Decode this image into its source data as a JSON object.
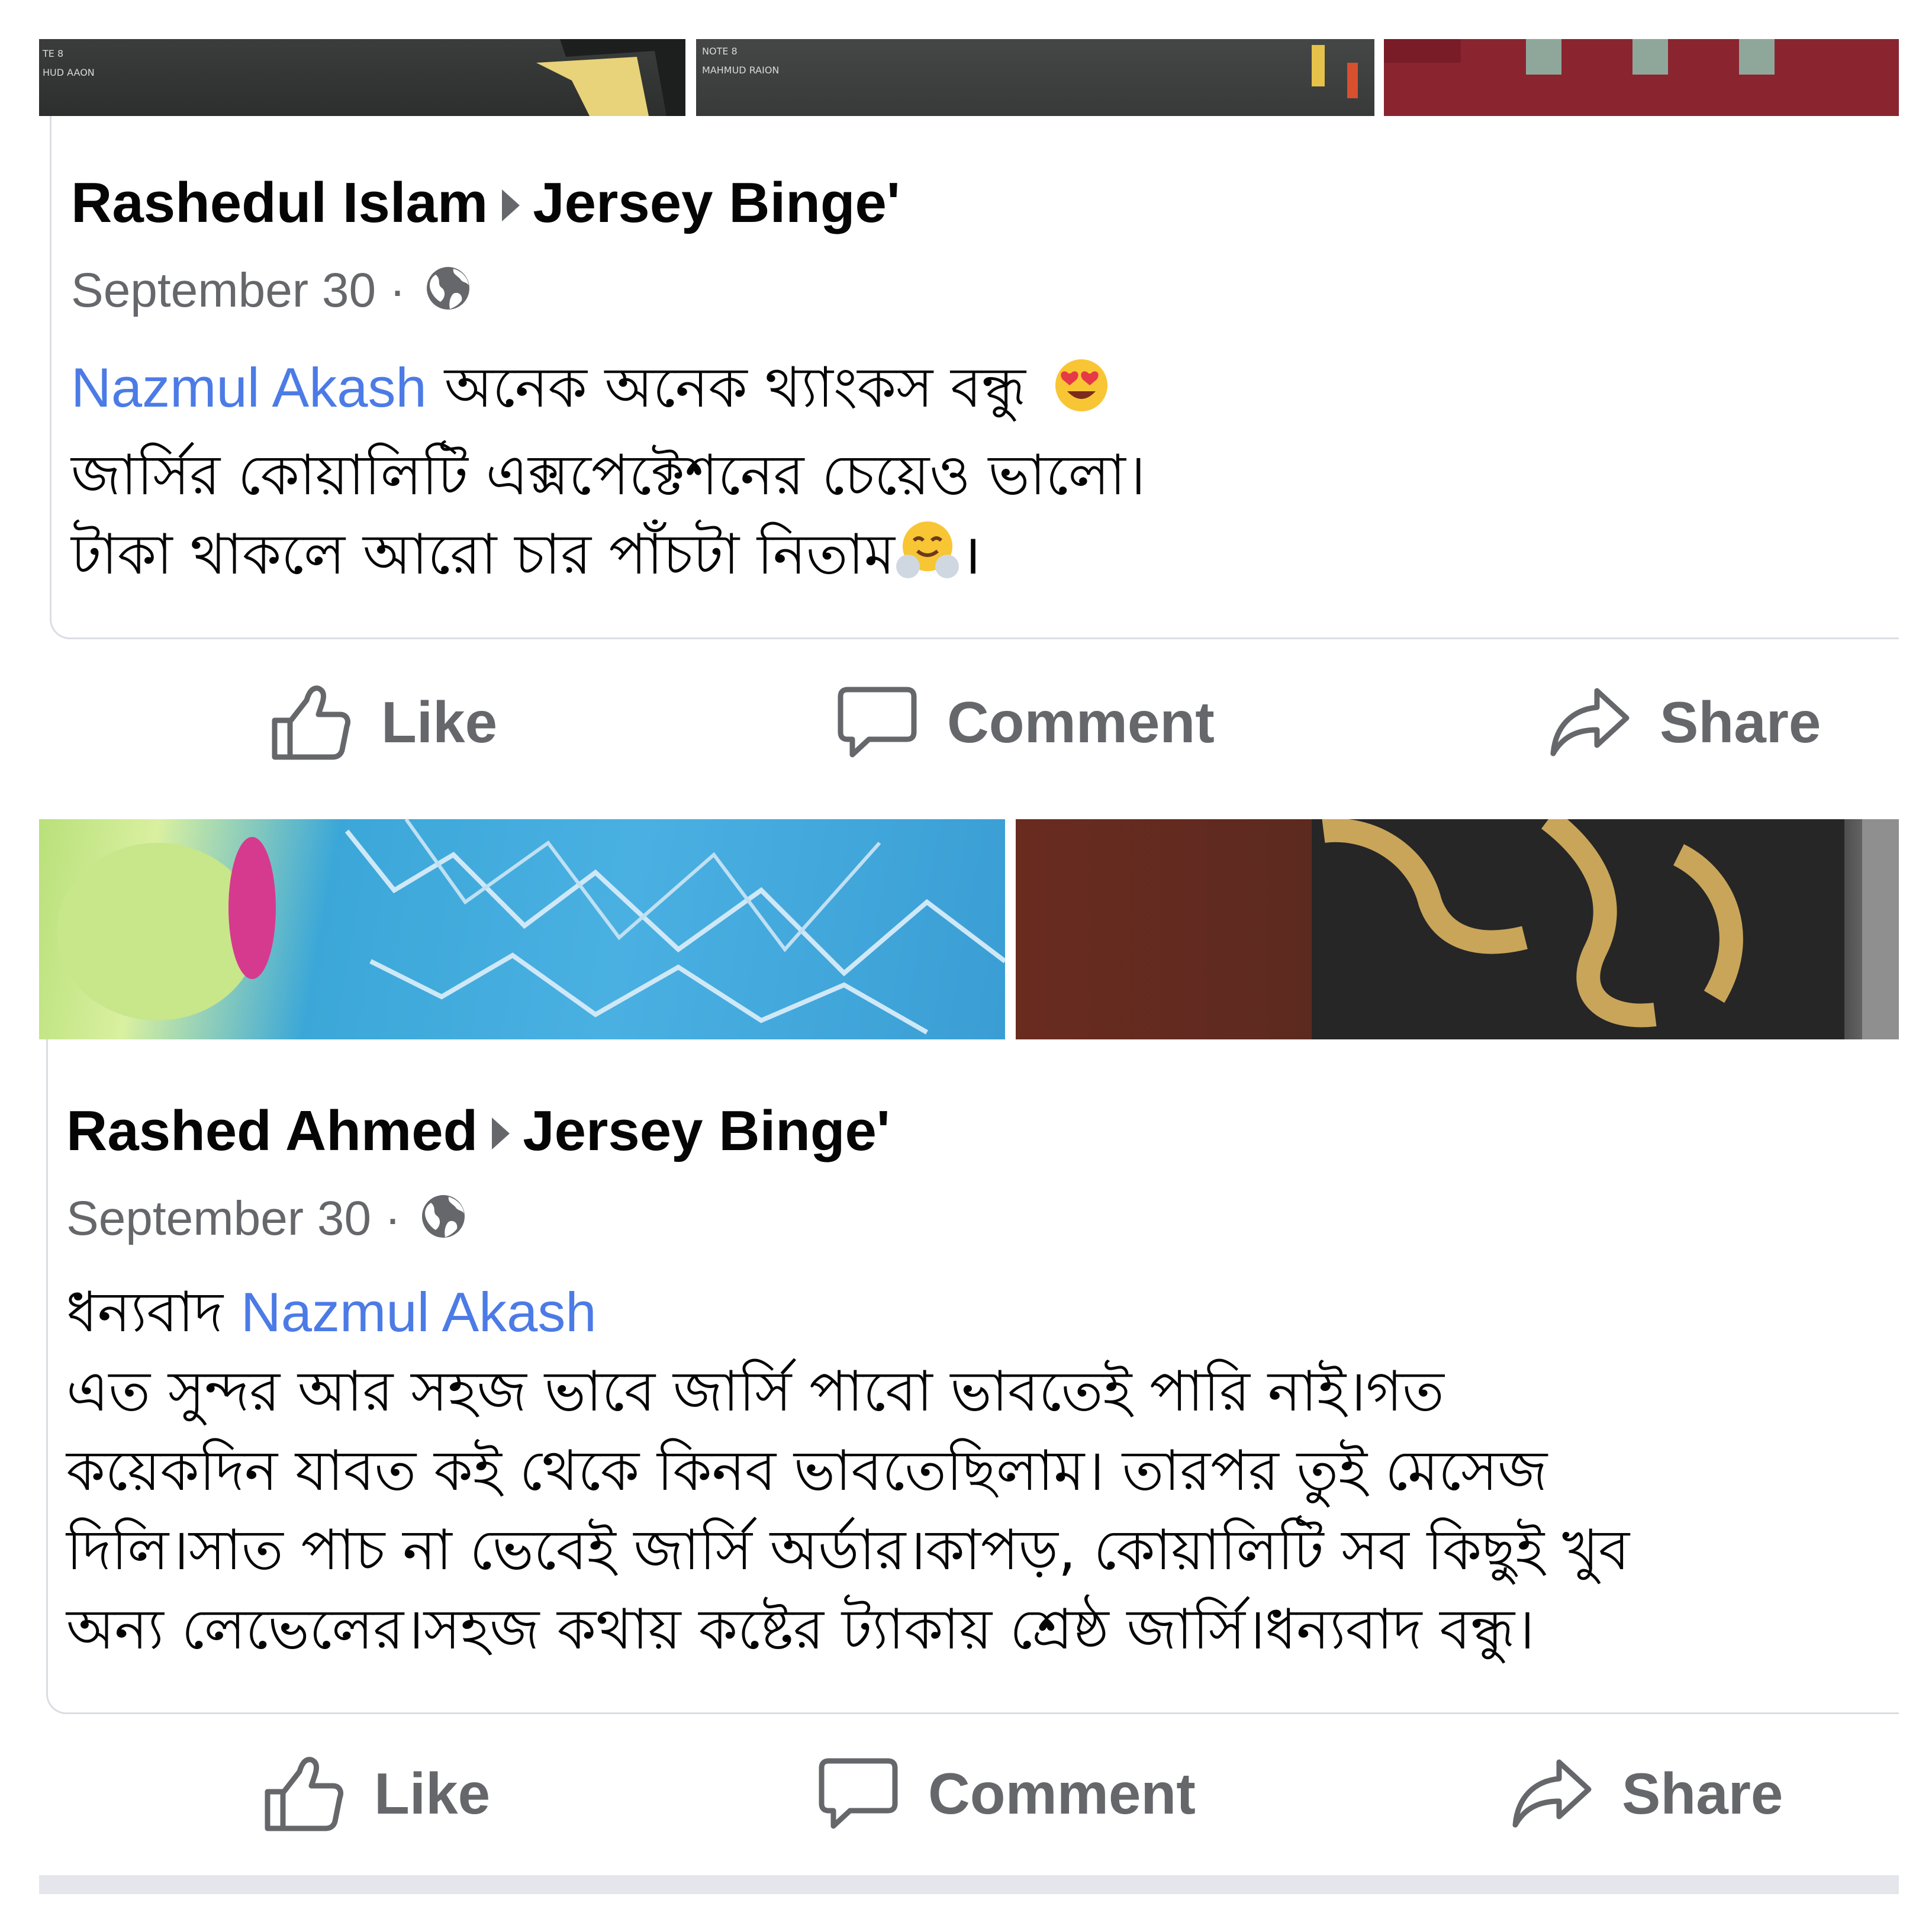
{
  "posts": [
    {
      "author": "Rashedul Islam",
      "group": "Jersey Binge'",
      "date": "September 30 · ",
      "lines": [
        {
          "mention": "Nazmul Akash",
          "text": " অনেক অনেক থ্যাংকস বন্ধু "
        },
        {
          "text": "জার্সির কোয়ালিটি এক্সপেক্টেশনের চেয়েও ভালো।"
        },
        {
          "text": "টাকা থাকলে আরো চার পাঁচটা নিতাম",
          "tail": "।"
        }
      ],
      "emojis": [
        "heart-eyes-emoji",
        "hugging-emoji"
      ],
      "actions": {
        "like": "Like",
        "comment": "Comment",
        "share": "Share"
      }
    },
    {
      "author": "Rashed Ahmed",
      "group": "Jersey Binge'",
      "date": "September 30 · ",
      "lines": [
        {
          "text": "ধন্যবাদ ",
          "mention": "Nazmul Akash"
        },
        {
          "text": "এত সুন্দর আর সহজ ভাবে জার্সি পাবো ভাবতেই পারি নাই।গত"
        },
        {
          "text": "কয়েকদিন যাবত কই থেকে কিনব ভাবতেছিলাম। তারপর তুই মেসেজ"
        },
        {
          "text": "দিলি।সাত পাচ না ভেবেই জার্সি অর্ডার।কাপড়, কোয়ালিটি সব কিছুই খুব"
        },
        {
          "text": "অন্য লেভেলের।সহজ কথায় কষ্টের ট্যাকায় শ্রেষ্ঠ জার্সি।ধন্যবাদ বন্ধু।"
        }
      ],
      "actions": {
        "like": "Like",
        "comment": "Comment",
        "share": "Share"
      }
    }
  ]
}
